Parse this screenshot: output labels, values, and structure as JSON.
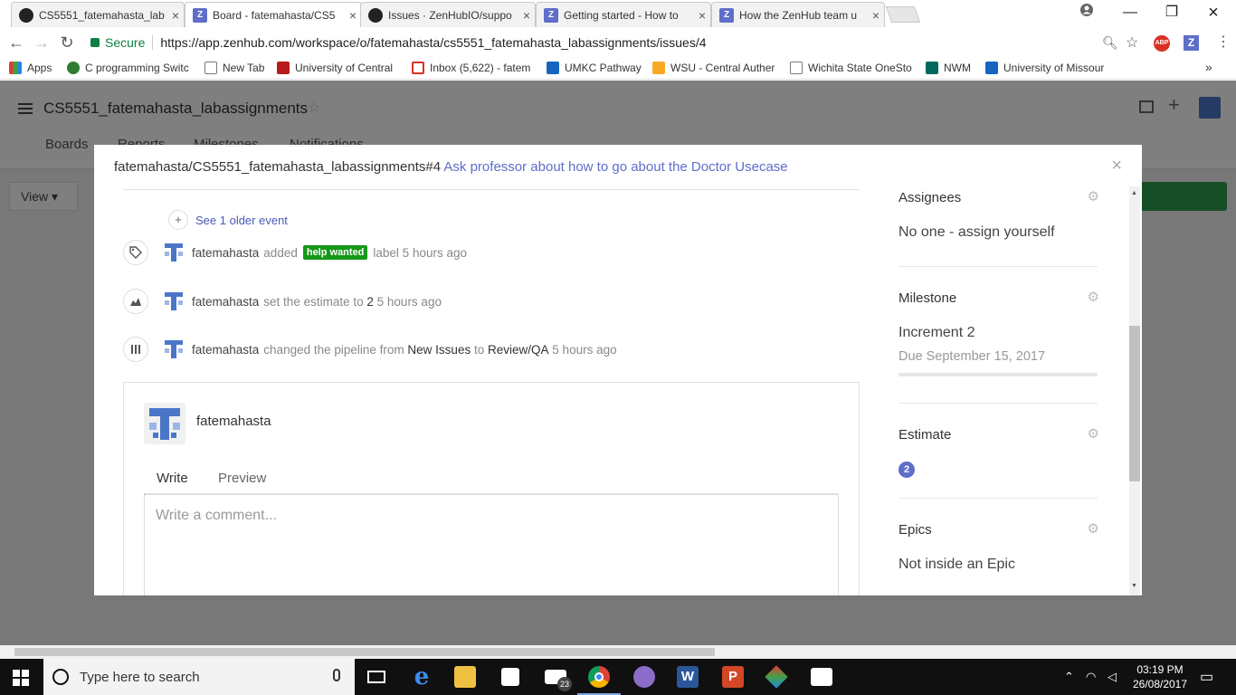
{
  "browser": {
    "tabs": [
      {
        "title": "CS5551_fatemahasta_lab",
        "favicon": "github-icon"
      },
      {
        "title": "Board - fatemahasta/CS5",
        "favicon": "zenhub-icon",
        "active": true
      },
      {
        "title": "Issues · ZenHubIO/suppo",
        "favicon": "github-icon"
      },
      {
        "title": "Getting started - How to",
        "favicon": "zenhub-icon"
      },
      {
        "title": "How the ZenHub team u",
        "favicon": "zenhub-icon"
      }
    ],
    "secure_label": "Secure",
    "url": "https://app.zenhub.com/workspace/o/fatemahasta/cs5551_fatemahasta_labassignments/issues/4",
    "ext_abp": "ABP",
    "ext_z": "Z",
    "bookmarks": [
      "Apps",
      "C programming Switc",
      "New Tab",
      "University of Central",
      "Inbox (5,622) - fatem",
      "UMKC Pathway",
      "WSU - Central Auther",
      "Wichita State OneSto",
      "NWM",
      "University of Missour"
    ]
  },
  "zenhub": {
    "repo_name": "CS5551_fatemahasta_labassignments",
    "nav_tabs": [
      "Boards",
      "Reports",
      "Milestones",
      "Notifications"
    ],
    "board_view": "View"
  },
  "modal": {
    "title_repo": "fatemahasta/CS5551_fatemahasta_labassignments#4",
    "title_issue": "Ask professor about how to go about the Doctor Usecase",
    "close": "×",
    "older_events": "See 1 older event",
    "events": [
      {
        "icon": "tag-icon",
        "user": "fatemahasta",
        "pre": "added",
        "label": "help wanted",
        "post": "label 5 hours ago"
      },
      {
        "icon": "estimate-icon",
        "user": "fatemahasta",
        "pre": "set the estimate to",
        "value": "2",
        "post": "5 hours ago"
      },
      {
        "icon": "pipeline-icon",
        "user": "fatemahasta",
        "pre": "changed the pipeline from",
        "from": "New Issues",
        "mid": "to",
        "to": "Review/QA",
        "post": "5 hours ago"
      }
    ],
    "comment": {
      "user": "fatemahasta",
      "tab_write": "Write",
      "tab_preview": "Preview",
      "placeholder": "Write a comment..."
    },
    "sidebar": {
      "assignees_h": "Assignees",
      "assignees_v": "No one - assign yourself",
      "milestone_h": "Milestone",
      "milestone_v": "Increment 2",
      "milestone_due": "Due September 15, 2017",
      "milestone_progress": 0,
      "estimate_h": "Estimate",
      "estimate_v": "2",
      "epics_h": "Epics",
      "epics_v": "Not inside an Epic"
    }
  },
  "taskbar": {
    "search_placeholder": "Type here to search",
    "mail_badge": "23",
    "time": "03:19 PM",
    "date": "26/08/2017"
  },
  "colors": {
    "accent": "#5e6ec9",
    "label_green": "#159818",
    "secure_green": "#0b8043"
  }
}
